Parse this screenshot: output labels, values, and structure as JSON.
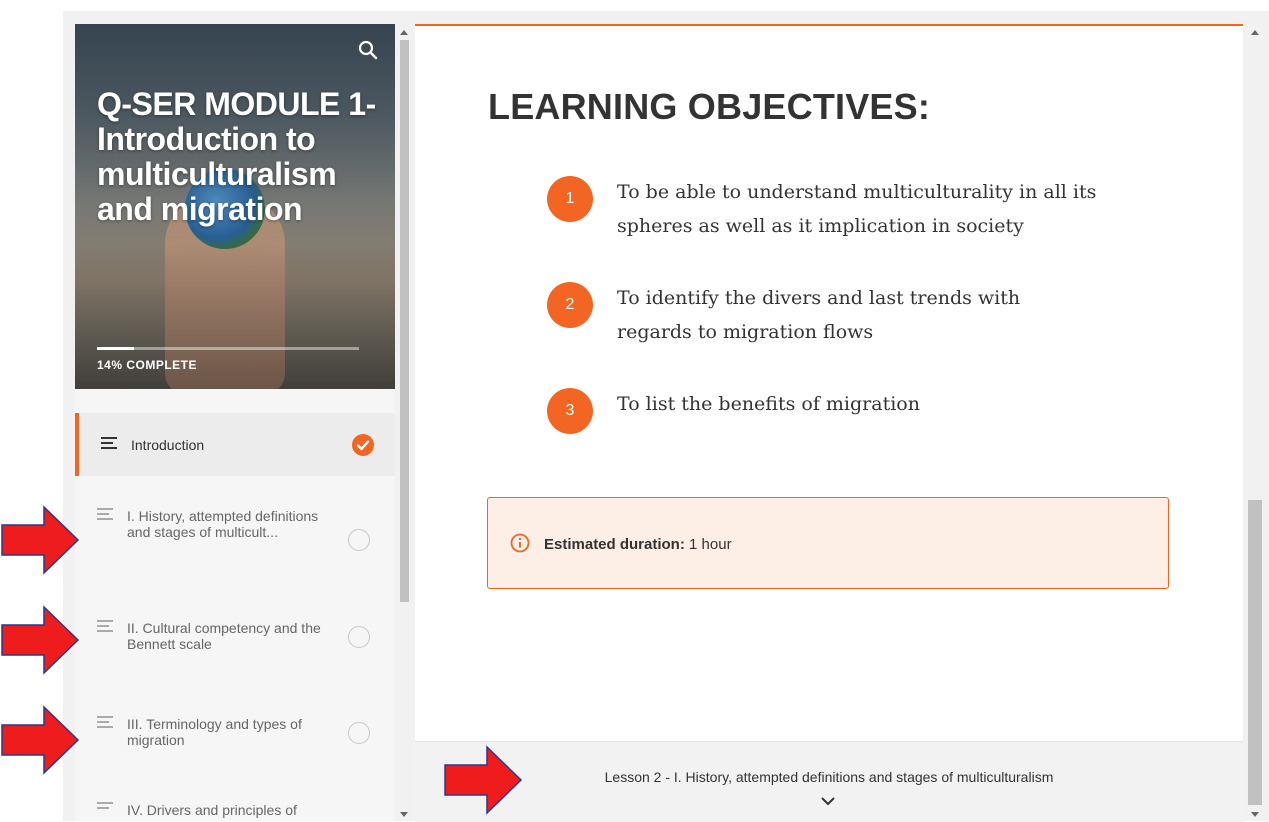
{
  "course": {
    "title": "Q-SER MODULE 1- Introduction to multiculturalism and migration",
    "progress_label": "14% COMPLETE",
    "progress_fraction": 0.14
  },
  "lessons": [
    {
      "label": "Introduction",
      "status": "complete"
    },
    {
      "label": "I. History, attempted definitions and stages of multicult...",
      "status": "incomplete"
    },
    {
      "label": "II. Cultural competency and the Bennett scale",
      "status": "incomplete"
    },
    {
      "label": "III. Terminology and types of migration",
      "status": "incomplete"
    },
    {
      "label": "IV. Drivers and principles of",
      "status": "incomplete"
    }
  ],
  "main": {
    "title": "LEARNING OBJECTIVES:",
    "objectives": [
      {
        "num": "1",
        "text": "To be able to understand multiculturality in all its spheres as well as it implication in society"
      },
      {
        "num": "2",
        "text": "To identify the divers and last trends with regards to migration flows"
      },
      {
        "num": "3",
        "text": "To list the benefits of migration"
      }
    ],
    "note": {
      "label": "Estimated duration:",
      "value": "1 hour"
    },
    "next_lesson": "Lesson 2 - I. History, attempted definitions and stages of multiculturalism"
  },
  "colors": {
    "accent": "#f26522",
    "annotation": "#ee1c1c"
  },
  "icons": [
    "search-icon",
    "menu-lines-icon",
    "check-icon",
    "info-icon",
    "chevron-down-icon",
    "red-arrow-icon"
  ]
}
